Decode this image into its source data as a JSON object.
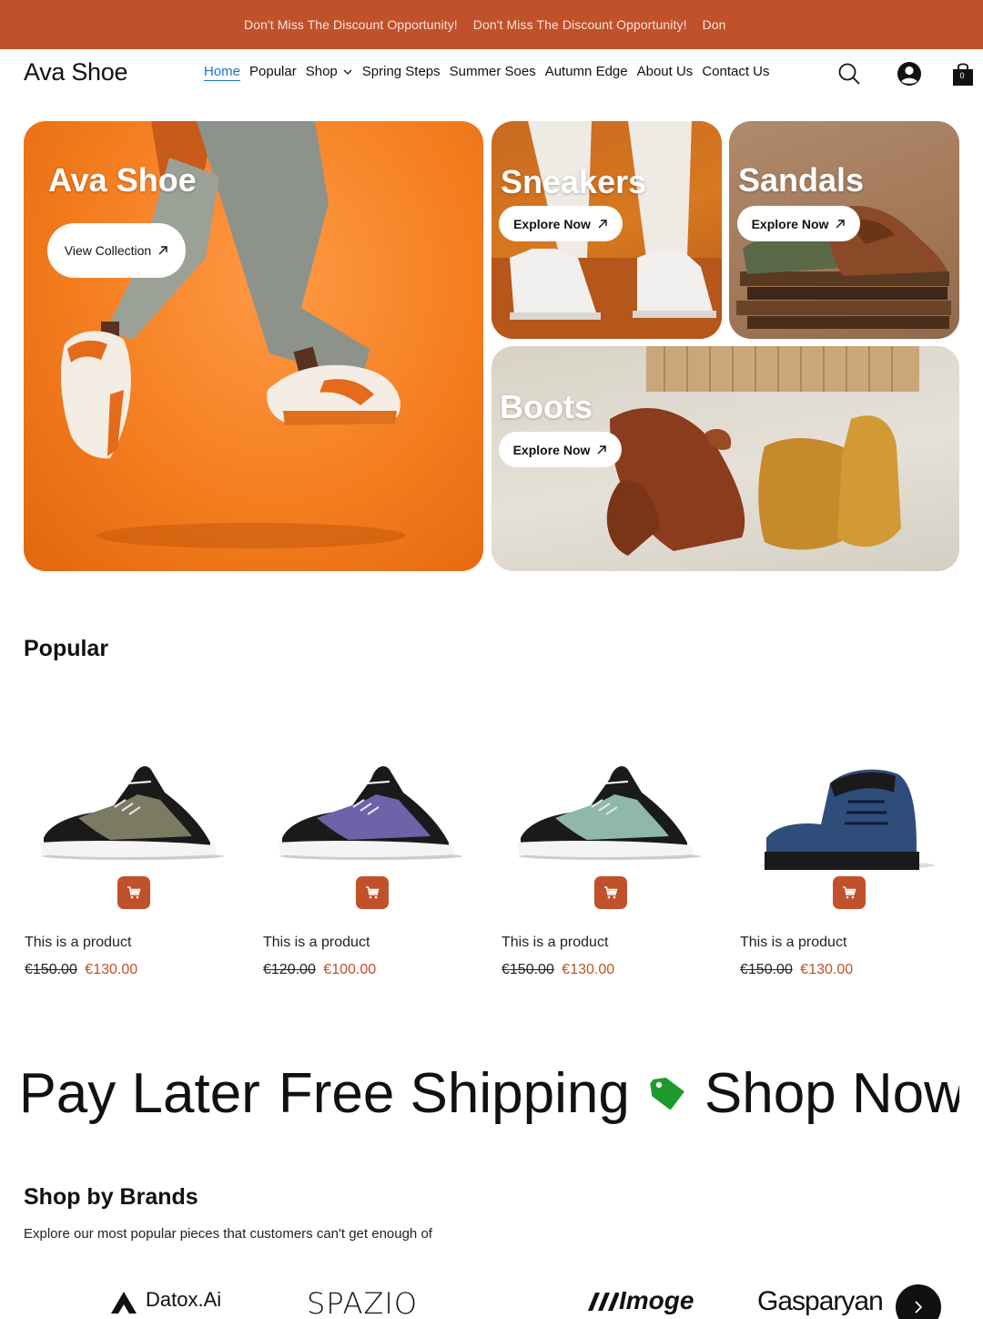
{
  "announcement": {
    "items": [
      "Don't Miss The Discount Opportunity!",
      "Don't Miss The Discount Opportunity!",
      "Don"
    ],
    "bg_color": "#c0512b"
  },
  "header": {
    "logo": "Ava Shoe",
    "nav": [
      {
        "label": "Home",
        "active": true
      },
      {
        "label": "Popular"
      },
      {
        "label": "Shop",
        "has_dropdown": true
      },
      {
        "label": "Spring Steps"
      },
      {
        "label": "Summer Soes"
      },
      {
        "label": "Autumn Edge"
      },
      {
        "label": "About Us"
      },
      {
        "label": "Contact Us"
      }
    ],
    "icons": [
      "search-icon",
      "account-icon",
      "shopping-bag-icon"
    ],
    "cart_count": "0"
  },
  "hero": {
    "main": {
      "title": "Ava Shoe",
      "button": "View Collection"
    },
    "sneakers": {
      "title": "Sneakers",
      "button": "Explore Now"
    },
    "sandals": {
      "title": "Sandals",
      "button": "Explore Now"
    },
    "boots": {
      "title": "Boots",
      "button": "Explore Now"
    }
  },
  "popular": {
    "title": "Popular",
    "products": [
      {
        "name": "This is a product",
        "old_price": "€150.00",
        "price": "€130.00",
        "color": "#7c7a62"
      },
      {
        "name": "This is a product",
        "old_price": "€120.00",
        "price": "€100.00",
        "color": "#6f62a8"
      },
      {
        "name": "This is a product",
        "old_price": "€150.00",
        "price": "€130.00",
        "color": "#8fb8a8"
      },
      {
        "name": "This is a product",
        "old_price": "€150.00",
        "price": "€130.00",
        "color": "#2e4d7a"
      }
    ]
  },
  "marquee": {
    "items": [
      ", Pay Later",
      "Free Shipping",
      "Shop Now"
    ],
    "icon": "price-tag-icon",
    "icon_color": "#1f9a2e"
  },
  "brands": {
    "title": "Shop by Brands",
    "subtitle": "Explore our most popular pieces that customers can't get enough of",
    "logos": [
      "Datox.Ai",
      "SPAZIO",
      "Imoge",
      "Gasparyan"
    ]
  },
  "colors": {
    "accent": "#c0512b",
    "link": "#1f6fd1"
  }
}
